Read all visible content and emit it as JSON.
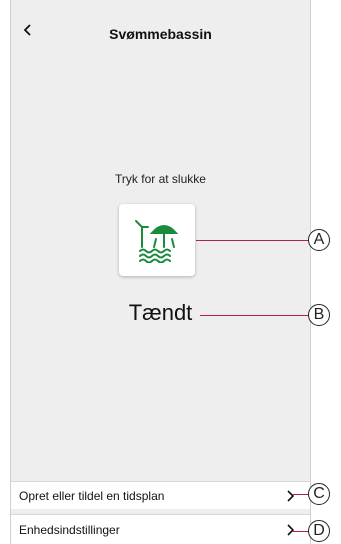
{
  "header": {
    "title": "Svømmebassin",
    "back_icon": "chevron-left-icon"
  },
  "control": {
    "hint": "Tryk for at slukke",
    "icon": "pool-umbrella-icon",
    "icon_color": "#1a8a3c",
    "state": "Tændt"
  },
  "menu": {
    "items": [
      {
        "label": "Opret eller tildel en tidsplan",
        "icon": "chevron-right-icon"
      },
      {
        "label": "Enhedsindstillinger",
        "icon": "chevron-right-icon"
      }
    ]
  },
  "callouts": {
    "a": "A",
    "b": "B",
    "c": "C",
    "d": "D",
    "line_color": "#b02050"
  }
}
